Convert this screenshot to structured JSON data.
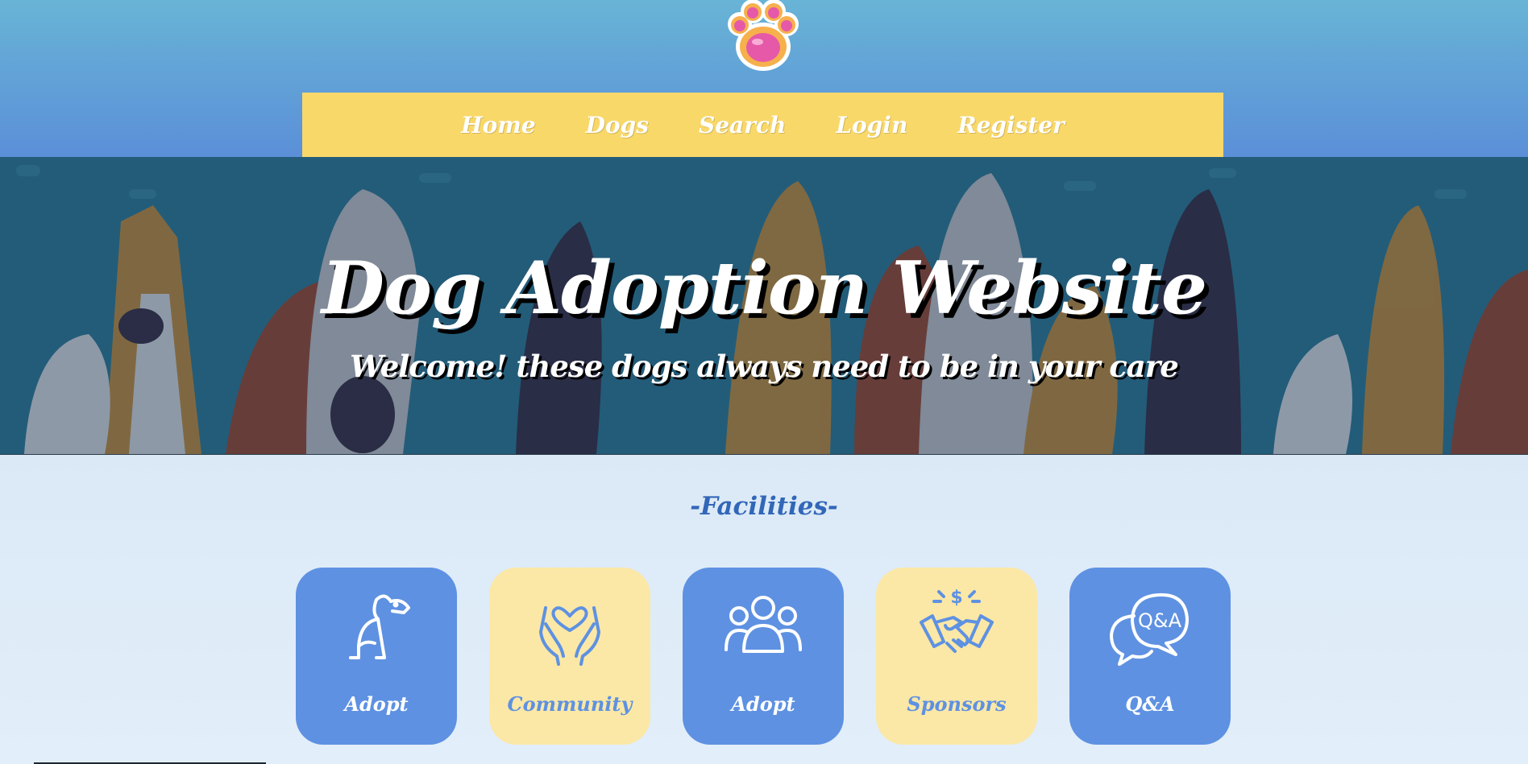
{
  "header": {
    "logo": "paw-icon",
    "nav": [
      "Home",
      "Dogs",
      "Search",
      "Login",
      "Register"
    ]
  },
  "hero": {
    "title": "Dog Adoption Website",
    "subtitle": "Welcome! these dogs always need to be in your care"
  },
  "facilities": {
    "title": "-Facilities-",
    "cards": [
      {
        "label": "Adopt",
        "icon": "dog-icon",
        "color": "#5e91e2"
      },
      {
        "label": "Community",
        "icon": "heart-hands-icon",
        "color": "#fbe8a6"
      },
      {
        "label": "Adopt",
        "icon": "people-group-icon",
        "color": "#5e91e2"
      },
      {
        "label": "Sponsors",
        "icon": "handshake-icon",
        "color": "#fbe8a6"
      },
      {
        "label": "Q&A",
        "icon": "qa-bubbles-icon",
        "color": "#5e91e2"
      }
    ]
  },
  "colors": {
    "nav_bg": "#f9d86a",
    "hero_bg": "#235c79",
    "accent_blue": "#5e91e2",
    "accent_yellow": "#fbe8a6"
  }
}
